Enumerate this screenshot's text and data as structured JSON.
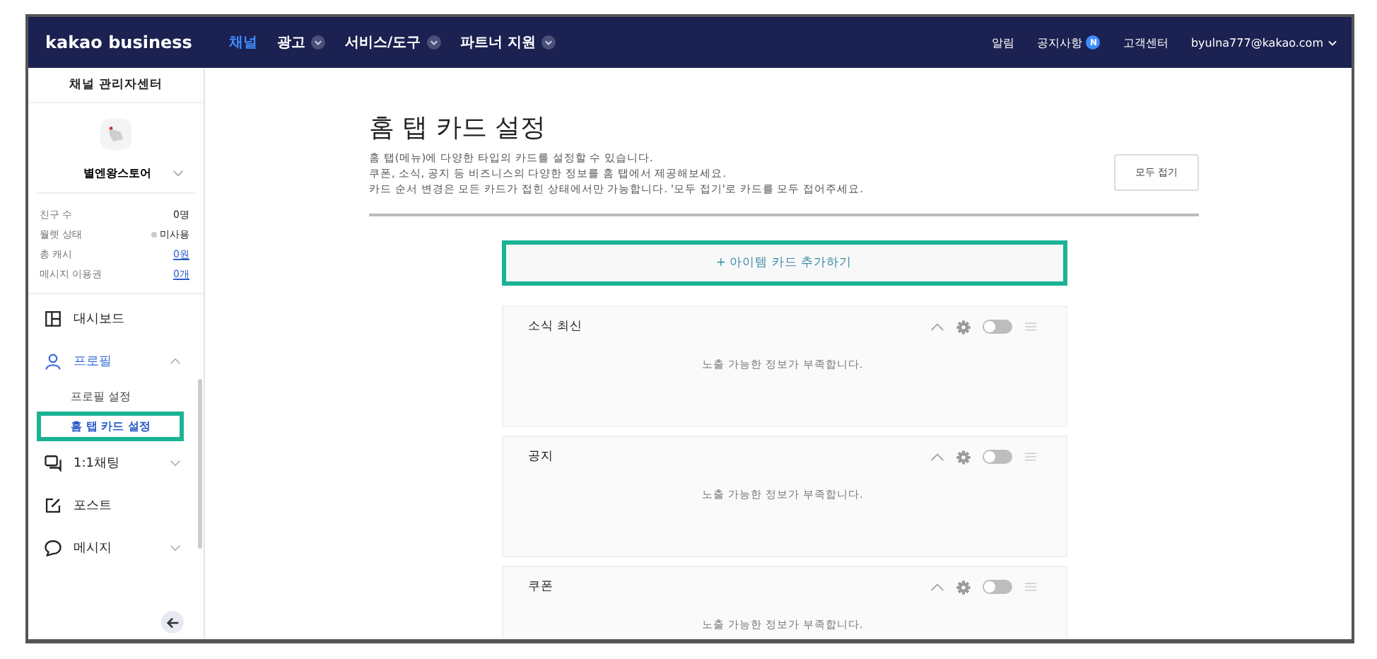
{
  "header": {
    "logo": "kakao business",
    "nav": [
      {
        "label": "채널",
        "selected": true,
        "dropdown": false
      },
      {
        "label": "광고",
        "selected": false,
        "dropdown": true
      },
      {
        "label": "서비스/도구",
        "selected": false,
        "dropdown": true
      },
      {
        "label": "파트너 지원",
        "selected": false,
        "dropdown": true
      }
    ],
    "links": [
      {
        "label": "알림"
      },
      {
        "label": "공지사항",
        "badge": "N"
      },
      {
        "label": "고객센터"
      }
    ],
    "account": "byulna777@kakao.com"
  },
  "sidebar": {
    "title": "채널 관리자센터",
    "channel_name": "별엔왕스토어",
    "stats": [
      {
        "label": "친구 수",
        "value": "0명",
        "link": false,
        "dot": false
      },
      {
        "label": "월렛 상태",
        "value": "미사용",
        "link": false,
        "dot": true
      },
      {
        "label": "총 캐시",
        "value": "0원",
        "link": true,
        "dot": false
      },
      {
        "label": "메시지 이용권",
        "value": "0개",
        "link": true,
        "dot": false
      }
    ],
    "menu": [
      {
        "label": "대시보드",
        "kind": "dashboard",
        "active": false
      },
      {
        "label": "프로필",
        "kind": "profile",
        "expanded": true,
        "active": true,
        "children": [
          {
            "label": "프로필 설정",
            "selected": false
          },
          {
            "label": "홈 탭 카드 설정",
            "selected": true
          }
        ]
      },
      {
        "label": "1:1채팅",
        "kind": "chat",
        "expanded": false,
        "active": false
      },
      {
        "label": "포스트",
        "kind": "post",
        "active": false
      },
      {
        "label": "메시지",
        "kind": "message",
        "expanded": false,
        "active": false
      }
    ]
  },
  "page": {
    "title": "홈 탭 카드 설정",
    "description": [
      "홈 탭(메뉴)에 다양한 타입의 카드를 설정할 수 있습니다.",
      "쿠폰, 소식, 공지 등 비즈니스의 다양한 정보를 홈 탭에서 제공해보세요.",
      "카드 순서 변경은 모든 카드가 접힌 상태에서만 가능합니다. '모두 접기'로 카드를 모두 접어주세요."
    ],
    "collapse_all": "모두 접기",
    "add_card": "+ 아이템 카드 추가하기",
    "cards": [
      {
        "title": "소식 최신",
        "on": false,
        "message": "노출 가능한 정보가 부족합니다."
      },
      {
        "title": "공지",
        "on": false,
        "message": "노출 가능한 정보가 부족합니다."
      },
      {
        "title": "쿠폰",
        "on": false,
        "message": "노출 가능한 정보가 부족합니다."
      }
    ]
  }
}
